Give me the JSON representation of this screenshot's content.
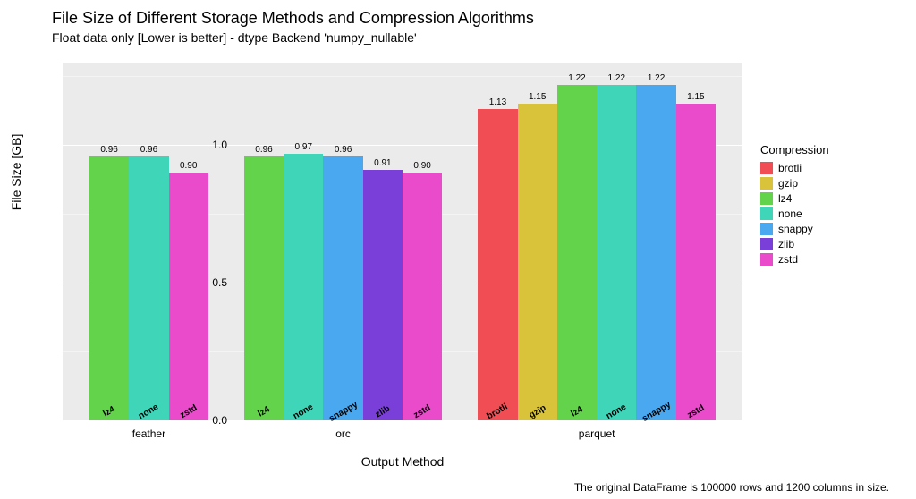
{
  "chart_data": {
    "type": "bar",
    "title": "File Size of Different Storage Methods and Compression Algorithms",
    "subtitle": "Float data only [Lower is better] - dtype Backend 'numpy_nullable'",
    "xlabel": "Output Method",
    "ylabel": "File Size [GB]",
    "caption": "The original DataFrame is 100000 rows and 1200 columns in size.",
    "ylim": [
      0,
      1.3
    ],
    "yticks": [
      0.0,
      0.5,
      1.0
    ],
    "legend_title": "Compression",
    "colors": {
      "brotli": "#f04e54",
      "gzip": "#d8c33a",
      "lz4": "#64d34c",
      "none": "#3ed5b9",
      "snappy": "#4aa8f0",
      "zlib": "#7a3fd8",
      "zstd": "#e94bcb"
    },
    "legend_order": [
      "brotli",
      "gzip",
      "lz4",
      "none",
      "snappy",
      "zlib",
      "zstd"
    ],
    "groups": [
      {
        "name": "feather",
        "bars": [
          {
            "comp": "lz4",
            "value": 0.96
          },
          {
            "comp": "none",
            "value": 0.96
          },
          {
            "comp": "zstd",
            "value": 0.9
          }
        ]
      },
      {
        "name": "orc",
        "bars": [
          {
            "comp": "lz4",
            "value": 0.96
          },
          {
            "comp": "none",
            "value": 0.97
          },
          {
            "comp": "snappy",
            "value": 0.96
          },
          {
            "comp": "zlib",
            "value": 0.91
          },
          {
            "comp": "zstd",
            "value": 0.9
          }
        ]
      },
      {
        "name": "parquet",
        "bars": [
          {
            "comp": "brotli",
            "value": 1.13
          },
          {
            "comp": "gzip",
            "value": 1.15
          },
          {
            "comp": "lz4",
            "value": 1.22
          },
          {
            "comp": "none",
            "value": 1.22
          },
          {
            "comp": "snappy",
            "value": 1.22
          },
          {
            "comp": "zstd",
            "value": 1.15
          }
        ]
      }
    ]
  }
}
